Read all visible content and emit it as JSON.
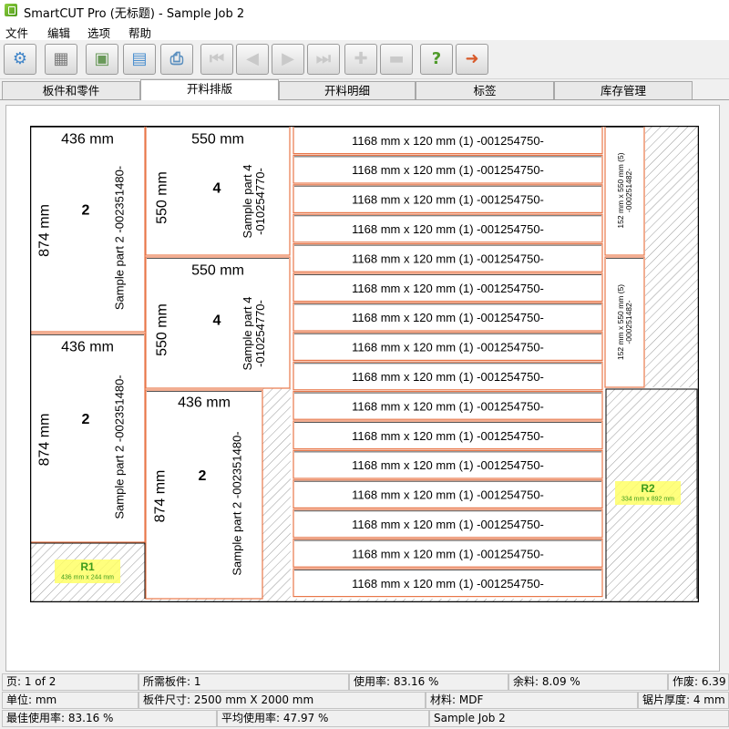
{
  "window": {
    "title": "SmartCUT Pro (无标题)  - Sample Job 2"
  },
  "menu": [
    "文件",
    "编辑",
    "选项",
    "帮助"
  ],
  "toolbar": [
    {
      "icon": "gear-icon",
      "enabled": true
    },
    {
      "icon": "calculator-icon",
      "enabled": true
    },
    {
      "icon": "save-icon",
      "enabled": true
    },
    {
      "icon": "open-folder-icon",
      "enabled": true
    },
    {
      "icon": "print-icon",
      "enabled": true
    },
    {
      "icon": "first-page-icon",
      "enabled": false
    },
    {
      "icon": "previous-page-icon",
      "enabled": false
    },
    {
      "icon": "next-page-icon",
      "enabled": false
    },
    {
      "icon": "last-page-icon",
      "enabled": false
    },
    {
      "icon": "zoom-in-icon",
      "enabled": false
    },
    {
      "icon": "zoom-out-icon",
      "enabled": false
    },
    {
      "icon": "help-icon",
      "enabled": true
    },
    {
      "icon": "exit-icon",
      "enabled": true
    }
  ],
  "tabs": [
    {
      "label": "板件和零件",
      "active": false
    },
    {
      "label": "开料排版",
      "active": true
    },
    {
      "label": "开料明细",
      "active": false
    },
    {
      "label": "标签",
      "active": false
    },
    {
      "label": "库存管理",
      "active": false
    }
  ],
  "layout": {
    "colors": {
      "part_border": "#e8774a",
      "sheet_border": "#000000",
      "scrap_label_bg": "#ffff66",
      "scrap_label_text": "#3c9b1c"
    },
    "parts": {
      "part2": {
        "width": "436 mm",
        "height": "874 mm",
        "qty": "2",
        "name": "Sample part 2  -002351480-"
      },
      "part4": {
        "width": "550 mm",
        "height": "550 mm",
        "qty": "4",
        "name": "Sample part 4\n-010254770-"
      },
      "strip": {
        "label": "1168 mm x 120 mm (1)  -001254750-"
      },
      "small": {
        "label": "152 mm x 550 mm (5)\n-000251482-"
      }
    },
    "remnants": {
      "r1": {
        "name": "R1",
        "size": "436 mm x 244 mm"
      },
      "r2": {
        "name": "R2",
        "size": "334 mm x 892 mm"
      }
    }
  },
  "status": {
    "page": "页: 1 of 2",
    "sheets_needed": "所需板件: 1",
    "usage": "使用率: 83.16 %",
    "remnant": "余料: 8.09 %",
    "work": "作废: 6.39",
    "unit": "单位: mm",
    "sheet_size": "板件尺寸: 2500 mm X 2000 mm",
    "material": "材料: MDF",
    "kerf": "锯片厚度: 4 mm",
    "best_usage": "最佳使用率: 83.16 %",
    "avg_usage": "平均使用率: 47.97 %",
    "job": "Sample Job 2"
  }
}
